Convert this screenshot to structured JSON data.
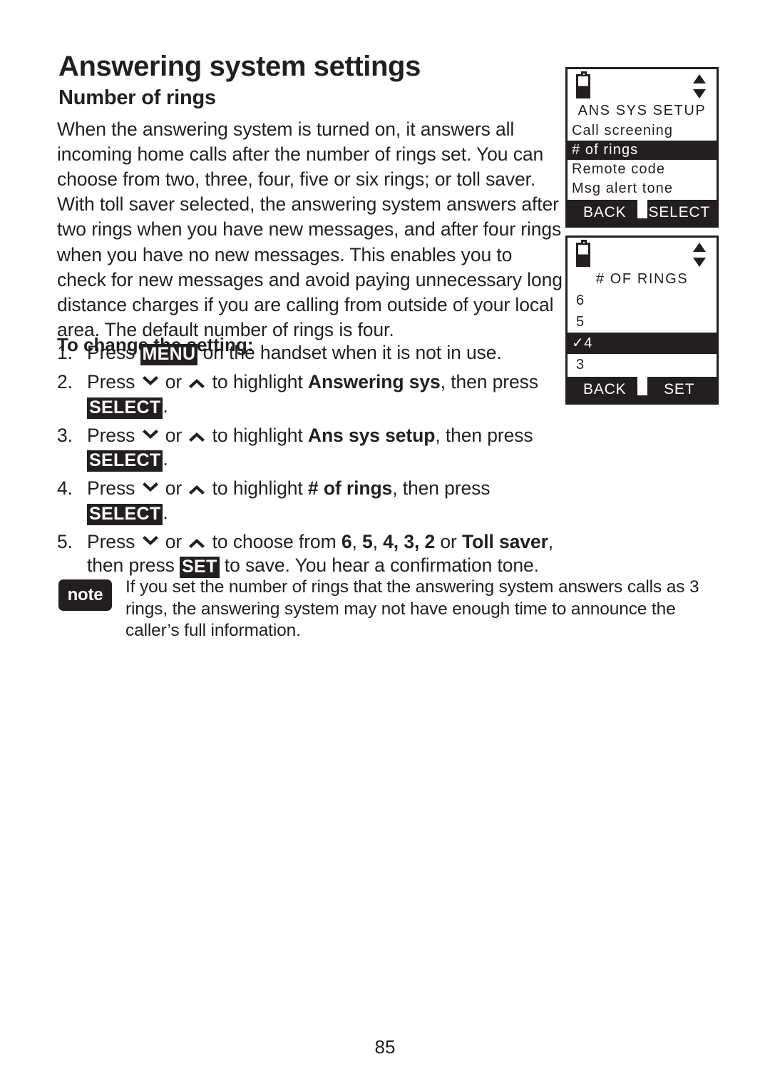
{
  "document": {
    "chapter_title": "Answering system settings",
    "section_title": "Number of rings",
    "page_number": "85"
  },
  "intro": {
    "paragraph": "When the answering system is turned on, it answers all incoming home calls after the number of rings set. You can choose from two, three, four, five or six rings; or toll saver. With toll saver selected, the answering system answers after two rings when you have new messages, and after four rings when you have no new messages. This enables you to check for new messages and avoid paying unnecessary long distance charges if you are calling from outside of your local area. The default number of rings is four."
  },
  "procedure": {
    "heading": "To change the setting:",
    "steps": [
      {
        "number": "1.",
        "parts": [
          {
            "type": "text",
            "value": "Press "
          },
          {
            "type": "key",
            "value": "MENU"
          },
          {
            "type": "text",
            "value": " on the handset when it is not in use."
          }
        ]
      },
      {
        "number": "2.",
        "parts": [
          {
            "type": "text",
            "value": "Press "
          },
          {
            "type": "icon",
            "value": "chevron-down-icon"
          },
          {
            "type": "text",
            "value": " or "
          },
          {
            "type": "icon",
            "value": "chevron-up-icon"
          },
          {
            "type": "text",
            "value": " to highlight "
          },
          {
            "type": "bold",
            "value": "Answering sys"
          },
          {
            "type": "text",
            "value": ", then press "
          },
          {
            "type": "key",
            "value": "SELECT"
          },
          {
            "type": "text",
            "value": "."
          }
        ]
      },
      {
        "number": "3.",
        "parts": [
          {
            "type": "text",
            "value": "Press "
          },
          {
            "type": "icon",
            "value": "chevron-down-icon"
          },
          {
            "type": "text",
            "value": " or "
          },
          {
            "type": "icon",
            "value": "chevron-up-icon"
          },
          {
            "type": "text",
            "value": " to highlight "
          },
          {
            "type": "bold",
            "value": "Ans sys setup"
          },
          {
            "type": "text",
            "value": ", then press "
          },
          {
            "type": "key",
            "value": "SELECT"
          },
          {
            "type": "text",
            "value": "."
          }
        ]
      },
      {
        "number": "4.",
        "parts": [
          {
            "type": "text",
            "value": "Press "
          },
          {
            "type": "icon",
            "value": "chevron-down-icon"
          },
          {
            "type": "text",
            "value": " or "
          },
          {
            "type": "icon",
            "value": "chevron-up-icon"
          },
          {
            "type": "text",
            "value": " to highlight "
          },
          {
            "type": "bold",
            "value": "# of rings"
          },
          {
            "type": "text",
            "value": ", then press "
          },
          {
            "type": "key",
            "value": "SELECT"
          },
          {
            "type": "text",
            "value": "."
          }
        ]
      },
      {
        "number": "5.",
        "parts": [
          {
            "type": "text",
            "value": "Press "
          },
          {
            "type": "icon",
            "value": "chevron-down-icon"
          },
          {
            "type": "text",
            "value": " or "
          },
          {
            "type": "icon",
            "value": "chevron-up-icon"
          },
          {
            "type": "text",
            "value": " to choose from "
          },
          {
            "type": "bold",
            "value": "6"
          },
          {
            "type": "text",
            "value": ", "
          },
          {
            "type": "bold",
            "value": "5"
          },
          {
            "type": "text",
            "value": ", "
          },
          {
            "type": "bold",
            "value": "4, 3, 2"
          },
          {
            "type": "text",
            "value": " or "
          },
          {
            "type": "bold",
            "value": "Toll saver"
          },
          {
            "type": "text",
            "value": ", then press "
          },
          {
            "type": "key",
            "value": "SET"
          },
          {
            "type": "text",
            "value": " to save. You hear a confirmation tone."
          }
        ]
      }
    ]
  },
  "note": {
    "badge_label": "note",
    "text": "If you set the number of rings that the answering system answers calls as 3 rings, the answering system may not have enough time to announce the caller’s full information."
  },
  "lcd_screens": [
    {
      "id": "ans-sys-setup",
      "status": {
        "battery_icon": "battery-half-icon",
        "scroll_icon": "scroll-up-down-icon"
      },
      "title": "ANS SYS SETUP",
      "rows": [
        {
          "label": "Call screening",
          "selected": false
        },
        {
          "label": "# of rings",
          "selected": true
        },
        {
          "label": "Remote code",
          "selected": false
        },
        {
          "label": "Msg alert tone",
          "selected": false
        }
      ],
      "softkeys": {
        "left": "BACK",
        "right": "SELECT"
      }
    },
    {
      "id": "number-of-rings",
      "status": {
        "battery_icon": "battery-half-icon",
        "scroll_icon": "scroll-up-down-icon"
      },
      "title": "# OF RINGS",
      "rows": [
        {
          "label": "6",
          "selected": false
        },
        {
          "label": "5",
          "selected": false
        },
        {
          "label": "✓4",
          "selected": true
        },
        {
          "label": "3",
          "selected": false
        }
      ],
      "softkeys": {
        "left": "BACK",
        "right": "SET"
      }
    }
  ]
}
